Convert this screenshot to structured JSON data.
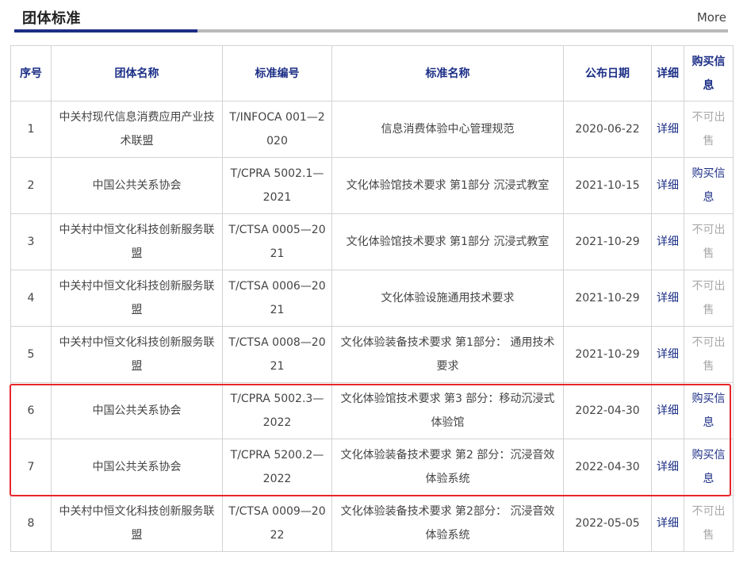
{
  "header": {
    "title": "团体标准",
    "more_label": "More"
  },
  "colors": {
    "accent": "#1c2f86",
    "highlight_border": "#e8262b",
    "unavailable_text": "#a8a8a8"
  },
  "table": {
    "columns": [
      "序号",
      "团体名称",
      "标准编号",
      "标准名称",
      "公布日期",
      "详细",
      "购买信息"
    ],
    "rows": [
      {
        "no": "1",
        "org": "中关村现代信息消费应用产业技术联盟",
        "code": "T/INFOCA 001—2020",
        "name": "信息消费体验中心管理规范",
        "date": "2020-06-22",
        "detail": "详细",
        "buy": "不可出售",
        "buy_available": false
      },
      {
        "no": "2",
        "org": "中国公共关系协会",
        "code": "T/CPRA 5002.1—2021",
        "name": "文化体验馆技术要求 第1部分 沉浸式教室",
        "date": "2021-10-15",
        "detail": "详细",
        "buy": "购买信息",
        "buy_available": true
      },
      {
        "no": "3",
        "org": "中关村中恒文化科技创新服务联盟",
        "code": "T/CTSA 0005—2021",
        "name": "文化体验馆技术要求 第1部分 沉浸式教室",
        "date": "2021-10-29",
        "detail": "详细",
        "buy": "不可出售",
        "buy_available": false
      },
      {
        "no": "4",
        "org": "中关村中恒文化科技创新服务联盟",
        "code": "T/CTSA 0006—2021",
        "name": "文化体验设施通用技术要求",
        "date": "2021-10-29",
        "detail": "详细",
        "buy": "不可出售",
        "buy_available": false
      },
      {
        "no": "5",
        "org": "中关村中恒文化科技创新服务联盟",
        "code": "T/CTSA 0008—2021",
        "name": "文化体验装备技术要求 第1部分： 通用技术要求",
        "date": "2021-10-29",
        "detail": "详细",
        "buy": "不可出售",
        "buy_available": false
      },
      {
        "no": "6",
        "org": "中国公共关系协会",
        "code": "T/CPRA 5002.3—2022",
        "name": "文化体验馆技术要求 第3 部分：移动沉浸式体验馆",
        "date": "2022-04-30",
        "detail": "详细",
        "buy": "购买信息",
        "buy_available": true
      },
      {
        "no": "7",
        "org": "中国公共关系协会",
        "code": "T/CPRA 5200.2—2022",
        "name": "文化体验装备技术要求 第2 部分：沉浸音效体验系统",
        "date": "2022-04-30",
        "detail": "详细",
        "buy": "购买信息",
        "buy_available": true
      },
      {
        "no": "8",
        "org": "中关村中恒文化科技创新服务联盟",
        "code": "T/CTSA 0009—2022",
        "name": "文化体验装备技术要求 第2部分： 沉浸音效体验系统",
        "date": "2022-05-05",
        "detail": "详细",
        "buy": "不可出售",
        "buy_available": false
      }
    ]
  }
}
